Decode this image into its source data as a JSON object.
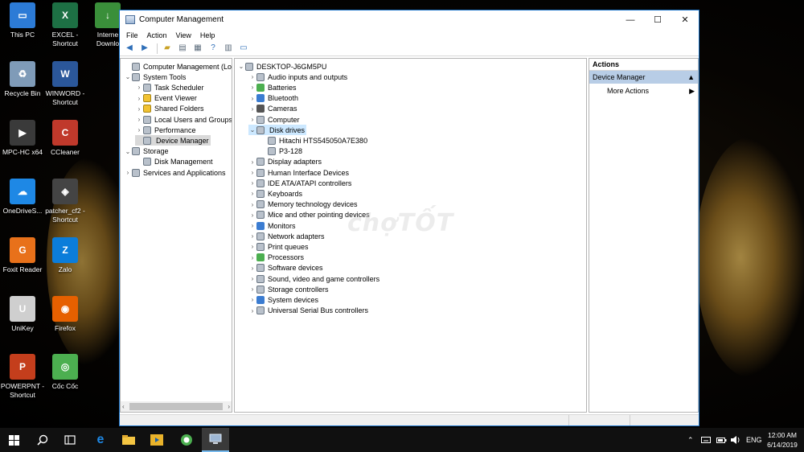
{
  "desktop": {
    "icons": [
      {
        "label": "This PC",
        "icon": "monitor-icon",
        "color": "#2c7bd6"
      },
      {
        "label": "EXCEL - Shortcut",
        "icon": "excel-icon",
        "color": "#1d7044"
      },
      {
        "label": "Interne Downlo",
        "icon": "idm-icon",
        "color": "#3a8f3a"
      },
      {
        "label": "Recycle Bin",
        "icon": "recycle-bin-icon",
        "color": "#7f9bb8"
      },
      {
        "label": "WINWORD - Shortcut",
        "icon": "word-icon",
        "color": "#2b579a"
      },
      {
        "label": "MPC-HC x64",
        "icon": "mpc-hc-icon",
        "color": "#3a3a3a"
      },
      {
        "label": "CCleaner",
        "icon": "ccleaner-icon",
        "color": "#c0392b"
      },
      {
        "label": "OneDriveS...",
        "icon": "onedrive-icon",
        "color": "#1e88e5"
      },
      {
        "label": "patcher_cf2 - Shortcut",
        "icon": "crossfire-icon",
        "color": "#444444"
      },
      {
        "label": "Foxit Reader",
        "icon": "foxit-icon",
        "color": "#e8711a"
      },
      {
        "label": "Zalo",
        "icon": "zalo-icon",
        "color": "#0b7dda"
      },
      {
        "label": "UniKey",
        "icon": "unikey-icon",
        "color": "#cfcfcf"
      },
      {
        "label": "Firefox",
        "icon": "firefox-icon",
        "color": "#e66000"
      },
      {
        "label": "POWERPNT - Shortcut",
        "icon": "powerpoint-icon",
        "color": "#c43e1c"
      },
      {
        "label": "Cốc Cốc",
        "icon": "coccoc-icon",
        "color": "#4caf50"
      }
    ]
  },
  "window": {
    "title": "Computer Management",
    "menu": [
      "File",
      "Action",
      "View",
      "Help"
    ],
    "controls": {
      "minimize": "—",
      "maximize": "☐",
      "close": "✕"
    }
  },
  "tree": [
    {
      "label": "Computer Management (Local",
      "icon": "computer-management-icon",
      "twisty": "",
      "icon_class": "ic-gray"
    },
    {
      "label": "System Tools",
      "icon": "system-tools-icon",
      "twisty": "⌄",
      "icon_class": "ic-gray"
    },
    {
      "label": "Task Scheduler",
      "icon": "clock-icon",
      "twisty": "›",
      "icon_class": "ic-gray"
    },
    {
      "label": "Event Viewer",
      "icon": "event-viewer-icon",
      "twisty": "›",
      "icon_class": "ic-yellow"
    },
    {
      "label": "Shared Folders",
      "icon": "folder-icon",
      "twisty": "›",
      "icon_class": "ic-yellow"
    },
    {
      "label": "Local Users and Groups",
      "icon": "users-icon",
      "twisty": "›",
      "icon_class": "ic-gray"
    },
    {
      "label": "Performance",
      "icon": "performance-icon",
      "twisty": "›",
      "icon_class": "ic-gray"
    },
    {
      "label": "Device Manager",
      "icon": "device-manager-icon",
      "twisty": "",
      "icon_class": "ic-gray"
    },
    {
      "label": "Storage",
      "icon": "storage-icon",
      "twisty": "⌄",
      "icon_class": "ic-gray"
    },
    {
      "label": "Disk Management",
      "icon": "disk-management-icon",
      "twisty": "",
      "icon_class": "ic-gray"
    },
    {
      "label": "Services and Applications",
      "icon": "services-icon",
      "twisty": "›",
      "icon_class": "ic-gray"
    }
  ],
  "devices": [
    {
      "label": "DESKTOP-J6GM5PU",
      "icon": "computer-icon",
      "twisty": "⌄",
      "icon_class": "ic-gray"
    },
    {
      "label": "Audio inputs and outputs",
      "icon": "speaker-icon",
      "twisty": "›",
      "icon_class": "ic-gray"
    },
    {
      "label": "Batteries",
      "icon": "battery-icon",
      "twisty": "›",
      "icon_class": "ic-green"
    },
    {
      "label": "Bluetooth",
      "icon": "bluetooth-icon",
      "twisty": "›",
      "icon_class": "ic-blue"
    },
    {
      "label": "Cameras",
      "icon": "camera-icon",
      "twisty": "›",
      "icon_class": "ic-dark"
    },
    {
      "label": "Computer",
      "icon": "computer-icon",
      "twisty": "›",
      "icon_class": "ic-gray"
    },
    {
      "label": "Disk drives",
      "icon": "disk-drive-icon",
      "twisty": "⌄",
      "icon_class": "ic-gray"
    },
    {
      "label": "Hitachi HTS545050A7E380",
      "icon": "disk-drive-icon",
      "twisty": "",
      "icon_class": "ic-gray"
    },
    {
      "label": "P3-128",
      "icon": "disk-drive-icon",
      "twisty": "",
      "icon_class": "ic-gray"
    },
    {
      "label": "Display adapters",
      "icon": "display-adapter-icon",
      "twisty": "›",
      "icon_class": "ic-gray"
    },
    {
      "label": "Human Interface Devices",
      "icon": "hid-icon",
      "twisty": "›",
      "icon_class": "ic-gray"
    },
    {
      "label": "IDE ATA/ATAPI controllers",
      "icon": "ide-controller-icon",
      "twisty": "›",
      "icon_class": "ic-gray"
    },
    {
      "label": "Keyboards",
      "icon": "keyboard-icon",
      "twisty": "›",
      "icon_class": "ic-gray"
    },
    {
      "label": "Memory technology devices",
      "icon": "memory-icon",
      "twisty": "›",
      "icon_class": "ic-gray"
    },
    {
      "label": "Mice and other pointing devices",
      "icon": "mouse-icon",
      "twisty": "›",
      "icon_class": "ic-gray"
    },
    {
      "label": "Monitors",
      "icon": "monitor-icon",
      "twisty": "›",
      "icon_class": "ic-blue"
    },
    {
      "label": "Network adapters",
      "icon": "network-icon",
      "twisty": "›",
      "icon_class": "ic-gray"
    },
    {
      "label": "Print queues",
      "icon": "printer-icon",
      "twisty": "›",
      "icon_class": "ic-gray"
    },
    {
      "label": "Processors",
      "icon": "processor-icon",
      "twisty": "›",
      "icon_class": "ic-green"
    },
    {
      "label": "Software devices",
      "icon": "software-device-icon",
      "twisty": "›",
      "icon_class": "ic-gray"
    },
    {
      "label": "Sound, video and game controllers",
      "icon": "sound-icon",
      "twisty": "›",
      "icon_class": "ic-gray"
    },
    {
      "label": "Storage controllers",
      "icon": "storage-controller-icon",
      "twisty": "›",
      "icon_class": "ic-gray"
    },
    {
      "label": "System devices",
      "icon": "system-devices-icon",
      "twisty": "›",
      "icon_class": "ic-blue"
    },
    {
      "label": "Universal Serial Bus controllers",
      "icon": "usb-icon",
      "twisty": "›",
      "icon_class": "ic-gray"
    }
  ],
  "actions": {
    "header": "Actions",
    "section": "Device Manager",
    "more": "More Actions"
  },
  "watermark": "chợTỐT",
  "taskbar": {
    "tray": {
      "chevron": "⌃",
      "language": "ENG"
    },
    "clock": {
      "time": "12:00 AM",
      "date": "6/14/2019"
    }
  },
  "colors": {
    "selection": "#cce8ff",
    "window_border": "#1a73c8",
    "actions_section": "#b8cde6"
  }
}
